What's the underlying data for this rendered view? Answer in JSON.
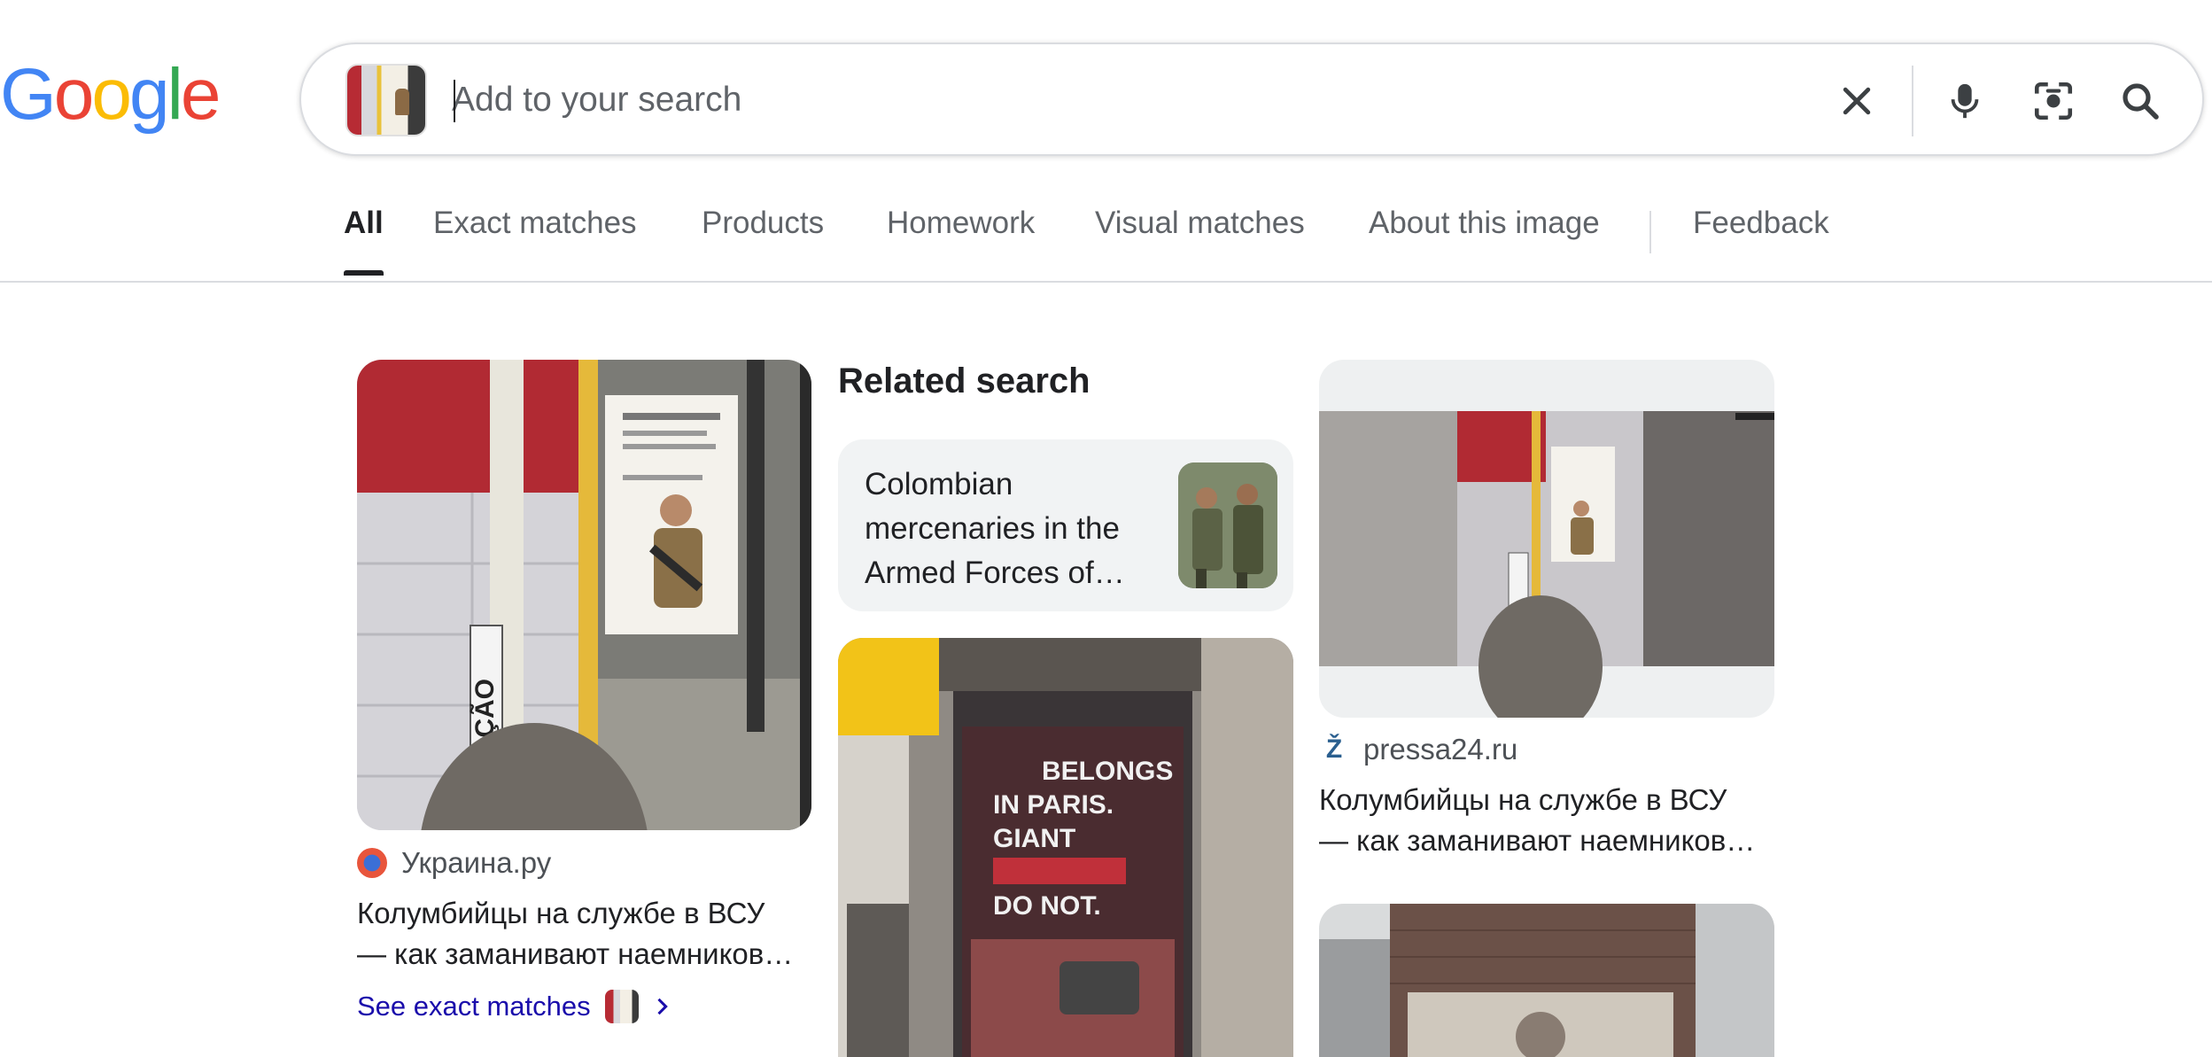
{
  "logo": {
    "letters": [
      "G",
      "o",
      "o",
      "g",
      "l",
      "e"
    ],
    "colors": [
      "#4285F4",
      "#EA4335",
      "#FBBC05",
      "#4285F4",
      "#34A853",
      "#EA4335"
    ]
  },
  "search": {
    "placeholder": "Add to your search",
    "value": "",
    "icons": [
      "image-chip-thumbnail",
      "clear-icon",
      "microphone-icon",
      "camera-lens-icon",
      "search-icon"
    ]
  },
  "tabs": [
    {
      "label": "All",
      "active": true
    },
    {
      "label": "Exact matches"
    },
    {
      "label": "Products"
    },
    {
      "label": "Homework"
    },
    {
      "label": "Visual matches"
    },
    {
      "label": "About this image"
    },
    {
      "label": "Feedback"
    }
  ],
  "results": {
    "left": {
      "source": "Украина.ру",
      "title_line1": "Колумбийцы на службе в ВСУ",
      "title_line2": "— как заманивают наемников…",
      "see_exact": "See exact matches"
    },
    "related": {
      "heading": "Related search",
      "card_line1": "Colombian",
      "card_line2": "mercenaries in the",
      "card_line3": "Armed Forces of…"
    },
    "middle_image": {
      "line1": "BELONGS",
      "line2": "IN PARIS.",
      "line3": "GIANT",
      "line4": "DO NOT."
    },
    "right": {
      "source": "pressa24.ru",
      "favicon_glyph": "Ž",
      "title_line1": "Колумбийцы на службе в ВСУ",
      "title_line2": "— как заманивают наемников…"
    },
    "sign_text": "RAÇÃO"
  },
  "colors": {
    "text": "#202124",
    "muted": "#5f6368",
    "link": "#1a0dab",
    "border": "#dadce0",
    "card_bg": "#f1f3f4"
  }
}
